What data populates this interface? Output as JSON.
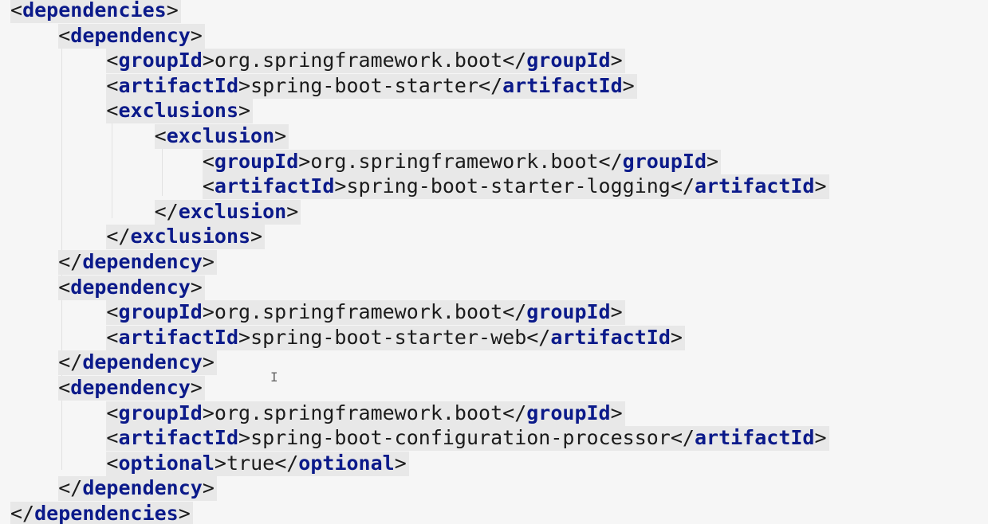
{
  "editor": {
    "lines": [
      {
        "indent": 0,
        "tag": "dependencies",
        "closing": false,
        "text": ""
      },
      {
        "indent": 1,
        "tag": "dependency",
        "closing": false,
        "text": ""
      },
      {
        "indent": 2,
        "tag": "groupId",
        "closing": false,
        "text": "org.springframework.boot"
      },
      {
        "indent": 2,
        "tag": "artifactId",
        "closing": false,
        "text": "spring-boot-starter"
      },
      {
        "indent": 2,
        "tag": "exclusions",
        "closing": false,
        "text": ""
      },
      {
        "indent": 3,
        "tag": "exclusion",
        "closing": false,
        "text": ""
      },
      {
        "indent": 4,
        "tag": "groupId",
        "closing": false,
        "text": "org.springframework.boot"
      },
      {
        "indent": 4,
        "tag": "artifactId",
        "closing": false,
        "text": "spring-boot-starter-logging"
      },
      {
        "indent": 3,
        "tag": "exclusion",
        "closing": true,
        "text": ""
      },
      {
        "indent": 2,
        "tag": "exclusions",
        "closing": true,
        "text": ""
      },
      {
        "indent": 1,
        "tag": "dependency",
        "closing": true,
        "text": ""
      },
      {
        "indent": 1,
        "tag": "dependency",
        "closing": false,
        "text": ""
      },
      {
        "indent": 2,
        "tag": "groupId",
        "closing": false,
        "text": "org.springframework.boot"
      },
      {
        "indent": 2,
        "tag": "artifactId",
        "closing": false,
        "text": "spring-boot-starter-web"
      },
      {
        "indent": 1,
        "tag": "dependency",
        "closing": true,
        "text": ""
      },
      {
        "indent": 1,
        "tag": "dependency",
        "closing": false,
        "text": ""
      },
      {
        "indent": 2,
        "tag": "groupId",
        "closing": false,
        "text": "org.springframework.boot"
      },
      {
        "indent": 2,
        "tag": "artifactId",
        "closing": false,
        "text": "spring-boot-configuration-processor"
      },
      {
        "indent": 2,
        "tag": "optional",
        "closing": false,
        "text": "true"
      },
      {
        "indent": 1,
        "tag": "dependency",
        "closing": true,
        "text": ""
      },
      {
        "indent": 0,
        "tag": "dependencies",
        "closing": true,
        "text": ""
      }
    ]
  },
  "colors": {
    "background": "#f6f6f6",
    "tag": "#0b1a8a",
    "text": "#1b1b1b",
    "highlight": "#e8e8e8"
  },
  "icons": {
    "cursor": "text-cursor-icon"
  }
}
